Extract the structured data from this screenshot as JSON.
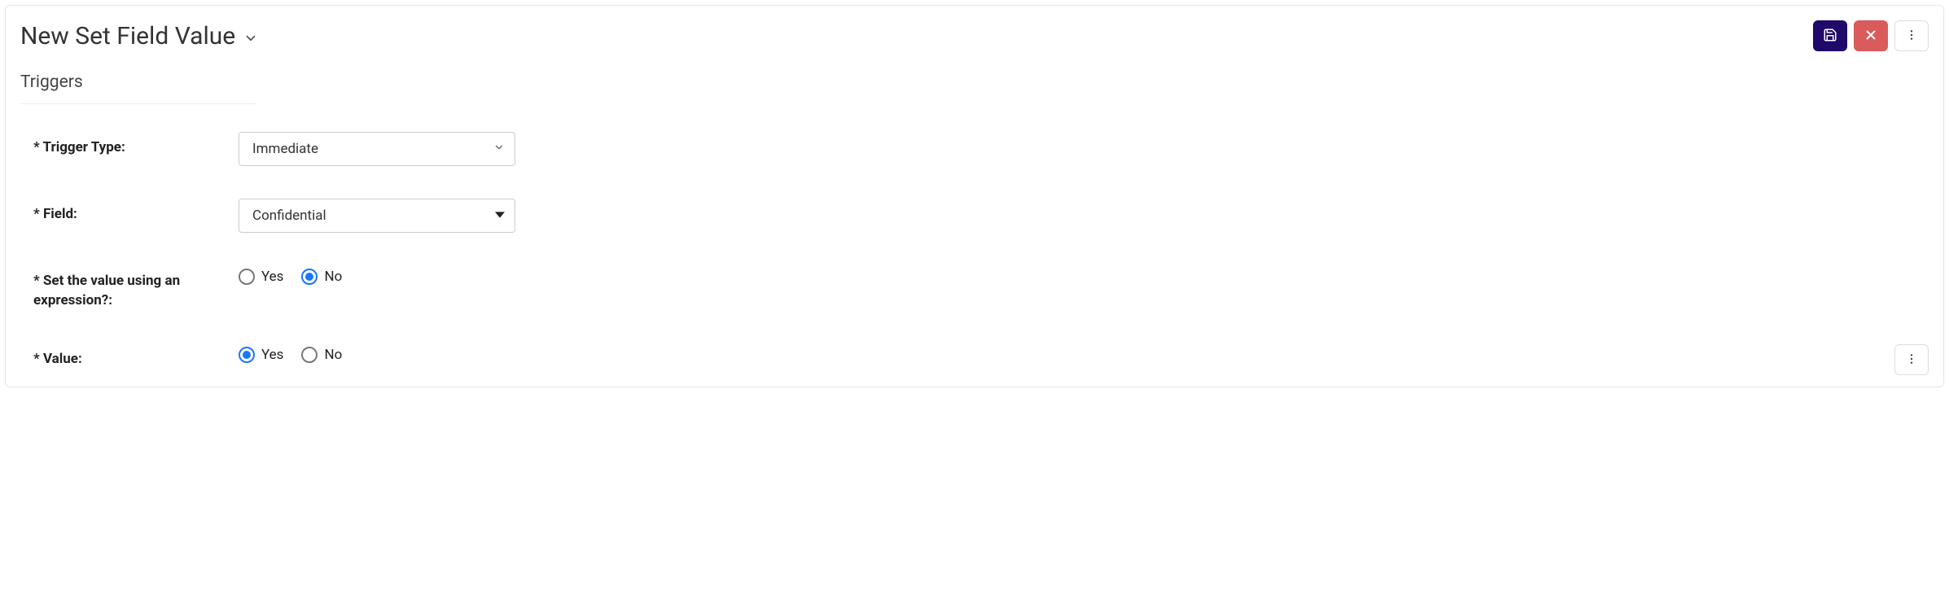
{
  "header": {
    "title": "New Set Field Value"
  },
  "section_title": "Triggers",
  "form": {
    "trigger_type": {
      "label": "* Trigger Type:",
      "value": "Immediate"
    },
    "field": {
      "label": "* Field:",
      "value": "Confidential"
    },
    "use_expression": {
      "label": "* Set the value using an expression?:",
      "options": {
        "yes": "Yes",
        "no": "No"
      },
      "selected": "no"
    },
    "value": {
      "label": "* Value:",
      "options": {
        "yes": "Yes",
        "no": "No"
      },
      "selected": "yes"
    }
  }
}
